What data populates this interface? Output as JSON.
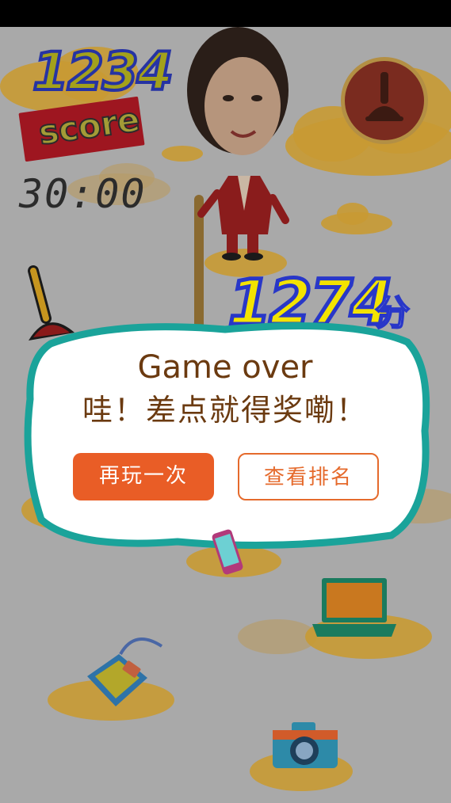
{
  "hud": {
    "score_value": "1234",
    "score_label": "score",
    "timer": "30:00"
  },
  "result": {
    "final_score": "1274",
    "unit": "分"
  },
  "dialog": {
    "title": "Game over",
    "message": "哇！差点就得奖嘞！",
    "replay_button": "再玩一次",
    "ranking_button": "查看排名"
  },
  "colors": {
    "background_overlay": "#a9a9a9",
    "dialog_border": "#1aa39a",
    "replay_button": "#e95d26",
    "dialog_text": "#6b3a10",
    "final_score_fill": "#f3e300",
    "final_score_outline": "#2837c8"
  },
  "icons": {
    "pause_button": "plunger-icon",
    "falling_items": [
      "phone-icon",
      "laptop-icon",
      "bag-icon",
      "camera-icon"
    ]
  }
}
